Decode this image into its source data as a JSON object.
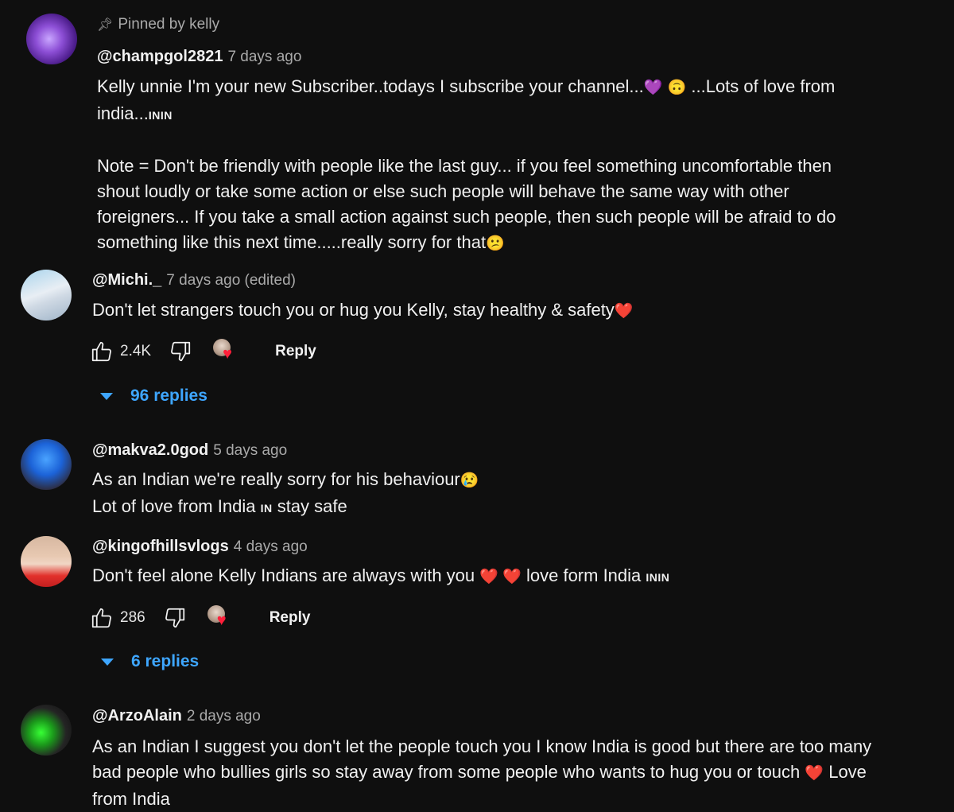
{
  "comments": [
    {
      "pinned_text": "Pinned by kelly",
      "handle": "@champgol2821",
      "time": "7 days ago",
      "text_parts": [
        "Kelly unnie I'm your new Subscriber..todays I subscribe your channel...",
        "💜",
        "🙃",
        "...Lots of love from",
        "india...",
        "ININ",
        "Note = Don't be friendly with people like the last guy... if you feel something uncomfortable then shout loudly or take some action or else such people will behave the same way with other foreigners... If you take a small action against such people, then such people will be afraid to do something like this next time.....really sorry for that",
        "😕"
      ]
    },
    {
      "handle": "@Michi._",
      "time": "7 days ago (edited)",
      "text": "Don't let strangers touch you or hug you Kelly, stay healthy & safety",
      "emoji": "❤️",
      "likes": "2.4K",
      "reply_label": "Reply",
      "replies_label": "96 replies"
    },
    {
      "handle": "@makva2.0god",
      "time": "5 days ago",
      "line1": "As an Indian we're really sorry for his  behaviour",
      "emoji": "😢",
      "line2a": "Lot of love from India",
      "flag": "IN",
      "line2b": "stay safe"
    },
    {
      "handle": "@kingofhillsvlogs",
      "time": "4 days ago",
      "text": "Don't feel alone Kelly Indians are always with you",
      "hearts": "❤️ ❤️",
      "text2": "love form India",
      "flag": "ININ",
      "likes": "286",
      "reply_label": "Reply",
      "replies_label": "6 replies"
    },
    {
      "handle": "@ArzoAlain",
      "time": "2 days ago",
      "text": "As an Indian I suggest you don't let the people touch you I know India is good but there are too many bad people who bullies girls so stay away from some people who wants to hug you or touch",
      "emoji": "❤️",
      "text2": "Love from India"
    }
  ],
  "icons": {
    "pin": "pin-icon",
    "like": "thumb-up-icon",
    "dislike": "thumb-down-icon",
    "creator_heart": "creator-heart-icon",
    "caret": "caret-down-icon"
  },
  "colors": {
    "background": "#0f0f0f",
    "text": "#f1f1f1",
    "secondary": "#aaaaaa",
    "link": "#3ea6ff",
    "heart": "#ff1f3a"
  }
}
